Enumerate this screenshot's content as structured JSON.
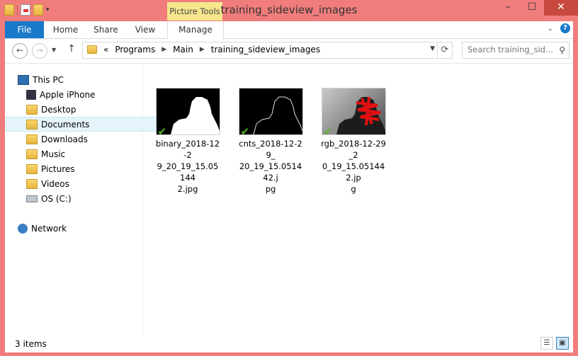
{
  "window": {
    "title": "training_sideview_images",
    "contextual_tab_group": "Picture Tools",
    "controls": {
      "minimize": "–",
      "maximize": "☐",
      "close": "✕"
    }
  },
  "ribbon": {
    "tabs": [
      "File",
      "Home",
      "Share",
      "View",
      "Manage"
    ]
  },
  "address": {
    "back_icon": "←",
    "forward_icon": "→",
    "up_icon": "↑",
    "overflow": "«",
    "breadcrumbs": [
      "Programs",
      "Main",
      "training_sideview_images"
    ],
    "search_placeholder": "Search training_sid...",
    "refresh_icon": "⟳",
    "search_icon": "⚲"
  },
  "navigation": {
    "this_pc": "This PC",
    "items": [
      "Apple iPhone",
      "Desktop",
      "Documents",
      "Downloads",
      "Music",
      "Pictures",
      "Videos",
      "OS (C:)"
    ],
    "selected": "Documents",
    "network": "Network"
  },
  "files": [
    {
      "name": "binary_2018-12-29_20_19_15.051442.jpg",
      "label_lines": [
        "binary_2018-12-2",
        "9_20_19_15.05144",
        "2.jpg"
      ]
    },
    {
      "name": "cnts_2018-12-29_20_19_15.051442.jpg",
      "label_lines": [
        "cnts_2018-12-29_",
        "20_19_15.051442.j",
        "pg"
      ]
    },
    {
      "name": "rgb_2018-12-29_20_19_15.051442.jpg",
      "label_lines": [
        "rgb_2018-12-29_2",
        "0_19_15.051442.jp",
        "g"
      ]
    }
  ],
  "status": {
    "item_count": "3 items"
  },
  "colors": {
    "accent": "#1979ca",
    "titlebar": "#f07c7c",
    "picture_tools": "#f6e68c",
    "close": "#c7483d"
  }
}
